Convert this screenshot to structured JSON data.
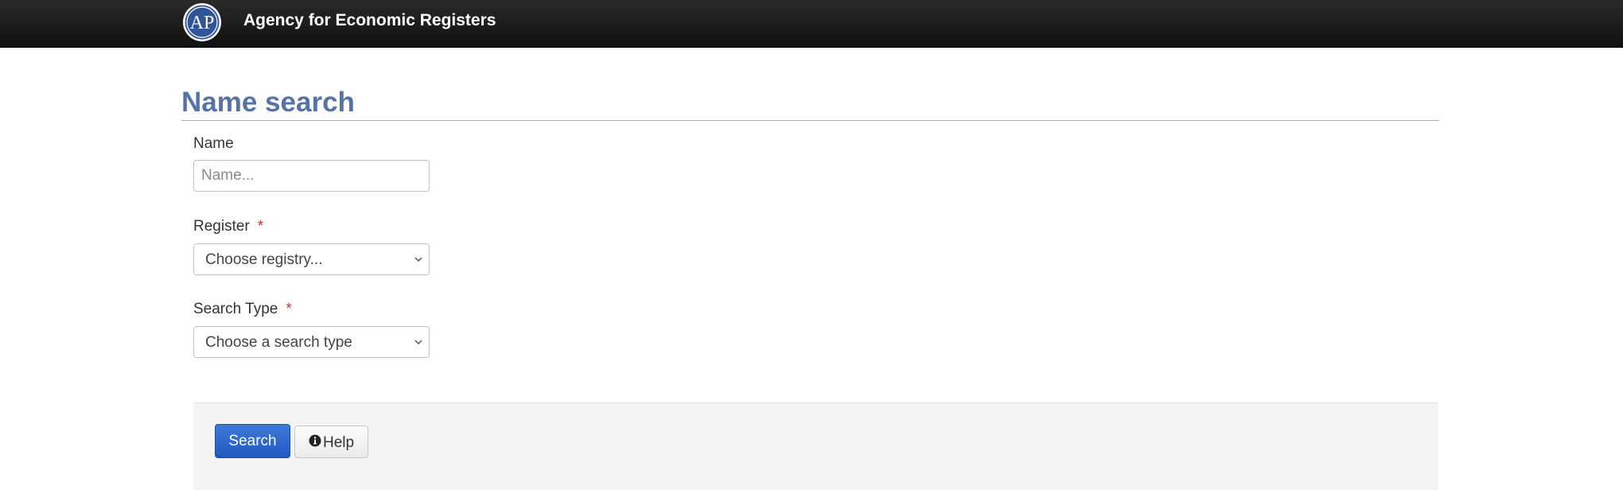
{
  "header": {
    "brand": "Agency for Economic Registers",
    "logo_text": "AP",
    "logo_icon": "apr-logo-icon"
  },
  "page": {
    "title": "Name search"
  },
  "form": {
    "name": {
      "label": "Name",
      "value": "",
      "placeholder": "Name..."
    },
    "register": {
      "label": "Register",
      "required_mark": "*",
      "selected": "Choose registry..."
    },
    "search_type": {
      "label": "Search Type",
      "required_mark": "*",
      "selected": "Choose a search type"
    }
  },
  "actions": {
    "search_label": "Search",
    "help_label": "Help",
    "help_icon": "info-circle-icon"
  },
  "colors": {
    "navbar": "#1a1a1a",
    "title": "#5673a8",
    "primary_button": "#2a63cc",
    "required": "#d9332b"
  }
}
